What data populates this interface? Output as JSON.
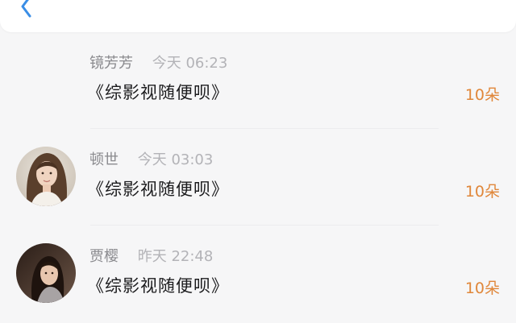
{
  "header": {
    "back_icon": "chevron-left-icon",
    "accent_color": "#3a8ee6"
  },
  "records": [
    {
      "name": "镜芳芳",
      "time": "今天 06:23",
      "title": "《综影视随便呗》",
      "count": "10朵",
      "has_avatar": false
    },
    {
      "name": "顿世",
      "time": "今天 03:03",
      "title": "《综影视随便呗》",
      "count": "10朵",
      "has_avatar": true
    },
    {
      "name": "贾樱",
      "time": "昨天 22:48",
      "title": "《综影视随便呗》",
      "count": "10朵",
      "has_avatar": true
    }
  ],
  "colors": {
    "count": "#e0873a",
    "name": "#8a8a8e",
    "time": "#b3b3b7",
    "title": "#1c1c1e"
  }
}
